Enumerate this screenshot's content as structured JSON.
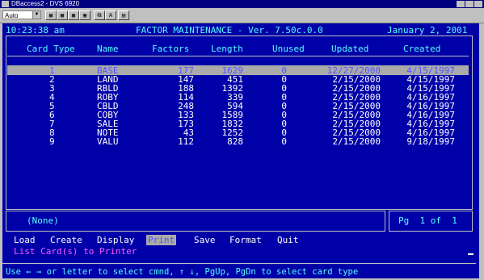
{
  "window": {
    "title": "DBaccess2 - DVS 6920"
  },
  "toolbar": {
    "font_select": "Auto",
    "buttons": [
      "grid-icon",
      "grid-icon",
      "grid-icon",
      "bold-icon",
      "print-icon",
      "icon",
      "font-icon"
    ]
  },
  "header": {
    "time": "10:23:38 am",
    "title": "FACTOR MAINTENANCE - Ver. 7.50c.0.0",
    "date": "January 2, 2001"
  },
  "table": {
    "columns": [
      "Card Type",
      "Name",
      "Factors",
      "Length",
      "Unused",
      "Updated",
      "Created"
    ],
    "rows": [
      {
        "type": "1",
        "name": "BASE",
        "factors": "177",
        "length": "1629",
        "unused": "0",
        "updated": "12/27/2000",
        "created": "4/15/1997"
      },
      {
        "type": "2",
        "name": "LAND",
        "factors": "147",
        "length": "451",
        "unused": "0",
        "updated": "2/15/2000",
        "created": "4/15/1997"
      },
      {
        "type": "3",
        "name": "RBLD",
        "factors": "188",
        "length": "1392",
        "unused": "0",
        "updated": "2/15/2000",
        "created": "4/15/1997"
      },
      {
        "type": "4",
        "name": "ROBY",
        "factors": "114",
        "length": "339",
        "unused": "0",
        "updated": "2/15/2000",
        "created": "4/16/1997"
      },
      {
        "type": "5",
        "name": "CBLD",
        "factors": "248",
        "length": "594",
        "unused": "0",
        "updated": "2/15/2000",
        "created": "4/16/1997"
      },
      {
        "type": "6",
        "name": "COBY",
        "factors": "133",
        "length": "1589",
        "unused": "0",
        "updated": "2/15/2000",
        "created": "4/16/1997"
      },
      {
        "type": "7",
        "name": "SALE",
        "factors": "173",
        "length": "1832",
        "unused": "0",
        "updated": "2/15/2000",
        "created": "4/16/1997"
      },
      {
        "type": "8",
        "name": "NOTE",
        "factors": "43",
        "length": "1252",
        "unused": "0",
        "updated": "2/15/2000",
        "created": "4/16/1997"
      },
      {
        "type": "9",
        "name": "VALU",
        "factors": "112",
        "length": "828",
        "unused": "0",
        "updated": "2/15/2000",
        "created": "9/18/1997"
      }
    ]
  },
  "footer": {
    "none_label": "(None)",
    "page_label": "Pg  1 of  1"
  },
  "menu": {
    "items": [
      "Load",
      "Create",
      "Display",
      "Print",
      "Save",
      "Format",
      "Quit"
    ],
    "selected": "Print"
  },
  "description": "List Card(s) to Printer",
  "status": "Use ← → or letter to select cmnd, ↑ ↓, PgUp, PgDn to select card type"
}
